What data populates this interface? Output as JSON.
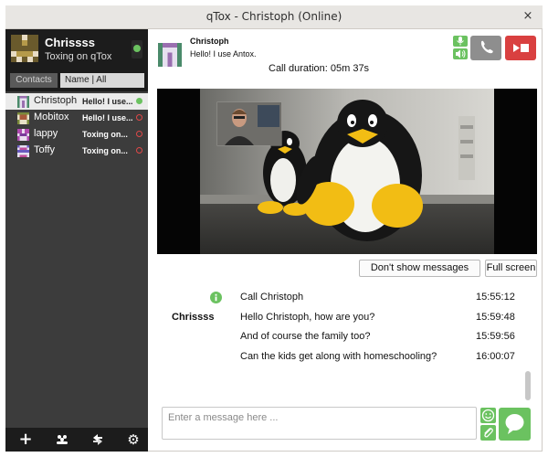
{
  "window": {
    "title": "qTox - Christoph (Online)",
    "close_glyph": "×"
  },
  "self": {
    "name": "Chrissss",
    "status_message": "Toxing on qTox",
    "status": "online"
  },
  "filter": {
    "contacts_label": "Contacts",
    "sort_label": "Name | All"
  },
  "contacts": [
    {
      "name": "Christoph",
      "message": "Hello! I use...",
      "status": "online",
      "active": true
    },
    {
      "name": "Mobitox",
      "message": "Hello! I use...",
      "status": "offline",
      "active": false
    },
    {
      "name": "lappy",
      "message": "Toxing on...",
      "status": "offline",
      "active": false
    },
    {
      "name": "Toffy",
      "message": "Toxing on...",
      "status": "offline",
      "active": false
    }
  ],
  "sidebar_bottom": {
    "icons": [
      "add-friend-icon",
      "group-icon",
      "file-transfer-icon",
      "settings-icon"
    ],
    "add_glyph": "+",
    "settings_glyph": "⚙"
  },
  "chat": {
    "contact_name": "Christoph",
    "contact_status": "Hello! I use Antox.",
    "call_duration": "Call duration: 05m 37s"
  },
  "buttons": {
    "dont_show_messages": "Don't show messages",
    "full_screen": "Full screen"
  },
  "messages": [
    {
      "author": "",
      "text": "Call Christoph",
      "time": "15:55:12",
      "kind": "system"
    },
    {
      "author": "Chrissss",
      "text": "Hello Christoph, how are you?",
      "time": "15:59:48",
      "kind": "message"
    },
    {
      "author": "",
      "text": "And of course the family too?",
      "time": "15:59:56",
      "kind": "message"
    },
    {
      "author": "",
      "text": "Can the kids get along with homeschooling?",
      "time": "16:00:07",
      "kind": "message"
    }
  ],
  "input": {
    "placeholder": "Enter a message here ..."
  },
  "colors": {
    "accent_green": "#6bc260",
    "hangup_red": "#d94040",
    "sidebar_dark": "#1c1c1c",
    "sidebar_bg": "#3c3c3c",
    "offline_red": "#e04848"
  }
}
